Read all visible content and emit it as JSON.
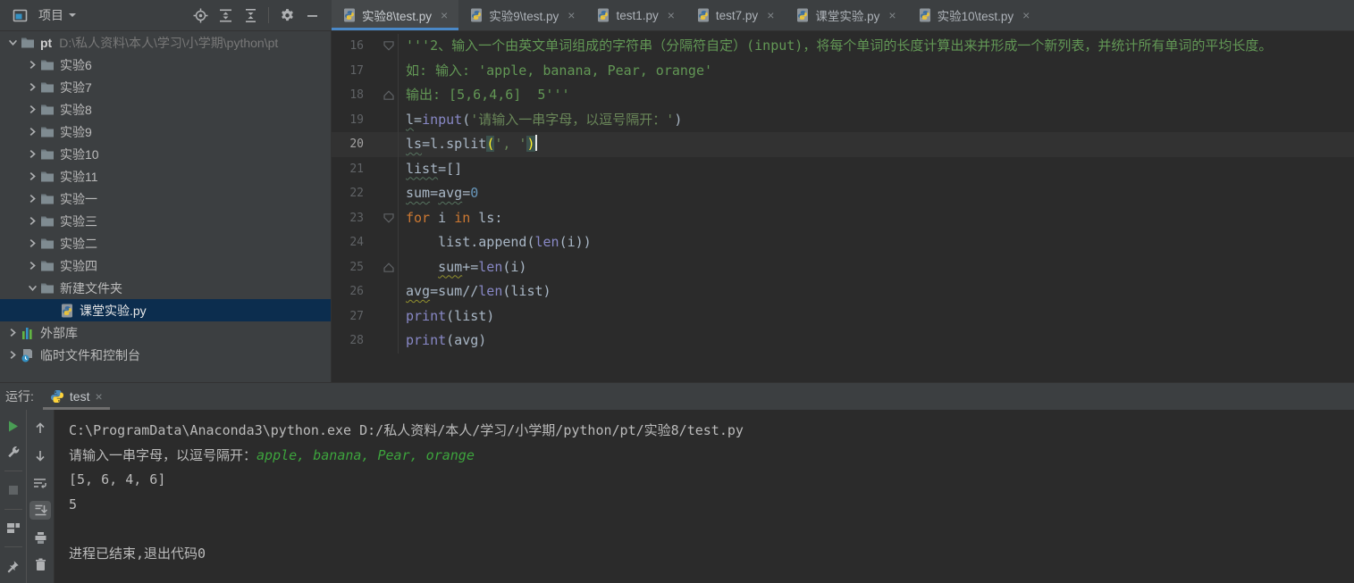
{
  "colors": {
    "accent_blue": "#4A88C7",
    "selection_navy": "#0C2D4E",
    "run_green": "#499C54",
    "console_input_green": "#3DA43D",
    "editor_bg": "#2B2B2B",
    "panel_bg": "#3C3F41"
  },
  "toolbar": {
    "project_label": "项目",
    "icons": [
      "locate",
      "expand-all",
      "collapse-all",
      "settings",
      "hide"
    ]
  },
  "editor_tabs": [
    {
      "label": "实验8\\test.py",
      "active": true
    },
    {
      "label": "实验9\\test.py",
      "active": false
    },
    {
      "label": "test1.py",
      "active": false
    },
    {
      "label": "test7.py",
      "active": false
    },
    {
      "label": "课堂实验.py",
      "active": false
    },
    {
      "label": "实验10\\test.py",
      "active": false
    }
  ],
  "project_tree": {
    "root": {
      "name": "pt",
      "path": "D:\\私人资料\\本人\\学习\\小学期\\python\\pt"
    },
    "items": [
      {
        "label": "实验6",
        "type": "folder",
        "chevron": "collapsed",
        "indent": 1
      },
      {
        "label": "实验7",
        "type": "folder",
        "chevron": "collapsed",
        "indent": 1
      },
      {
        "label": "实验8",
        "type": "folder",
        "chevron": "collapsed",
        "indent": 1
      },
      {
        "label": "实验9",
        "type": "folder",
        "chevron": "collapsed",
        "indent": 1
      },
      {
        "label": "实验10",
        "type": "folder",
        "chevron": "collapsed",
        "indent": 1
      },
      {
        "label": "实验11",
        "type": "folder",
        "chevron": "collapsed",
        "indent": 1
      },
      {
        "label": "实验一",
        "type": "folder",
        "chevron": "collapsed",
        "indent": 1
      },
      {
        "label": "实验三",
        "type": "folder",
        "chevron": "collapsed",
        "indent": 1
      },
      {
        "label": "实验二",
        "type": "folder",
        "chevron": "collapsed",
        "indent": 1
      },
      {
        "label": "实验四",
        "type": "folder",
        "chevron": "collapsed",
        "indent": 1
      },
      {
        "label": "新建文件夹",
        "type": "folder",
        "chevron": "expanded",
        "indent": 1
      },
      {
        "label": "课堂实验.py",
        "type": "pyfile",
        "chevron": "none",
        "indent": 2,
        "selected": true
      },
      {
        "label": "外部库",
        "type": "library",
        "chevron": "collapsed",
        "indent": 0
      },
      {
        "label": "临时文件和控制台",
        "type": "scratch",
        "chevron": "collapsed",
        "indent": 0
      }
    ]
  },
  "editor": {
    "lines": [
      {
        "no": "16",
        "fold": "down",
        "seg": [
          [
            "doc",
            "'''2、输入一个由英文单词组成的字符串（分隔符自定）(input)，将每个单词的长度计算出来并形成一个新列表，并统计所有单词的平均长度。"
          ]
        ]
      },
      {
        "no": "17",
        "fold": "none",
        "seg": [
          [
            "doc",
            "如: 输入: 'apple, banana, Pear, orange'"
          ]
        ]
      },
      {
        "no": "18",
        "fold": "up",
        "seg": [
          [
            "doc",
            "输出: [5,6,4,6]  5'''"
          ]
        ]
      },
      {
        "no": "19",
        "fold": "none",
        "seg": [
          [
            "pl wavy",
            "l"
          ],
          [
            "pl",
            "="
          ],
          [
            "fn",
            "input"
          ],
          [
            "pl",
            "("
          ],
          [
            "str",
            "'请输入一串字母，以逗号隔开：'"
          ],
          [
            "pl",
            ")"
          ]
        ]
      },
      {
        "no": "20",
        "fold": "none",
        "current": true,
        "caret": true,
        "seg": [
          [
            "pl wavy",
            "ls"
          ],
          [
            "pl",
            "="
          ],
          [
            "pl",
            "l.split"
          ],
          [
            "brace",
            "("
          ],
          [
            "str",
            "', '"
          ],
          [
            "brace",
            ")"
          ]
        ]
      },
      {
        "no": "21",
        "fold": "none",
        "seg": [
          [
            "pl wavy",
            "list"
          ],
          [
            "pl",
            "=[]"
          ]
        ]
      },
      {
        "no": "22",
        "fold": "none",
        "seg": [
          [
            "pl wavy",
            "sum"
          ],
          [
            "pl",
            "="
          ],
          [
            "pl wavy",
            "avg"
          ],
          [
            "pl",
            "="
          ],
          [
            "num",
            "0"
          ]
        ]
      },
      {
        "no": "23",
        "fold": "down",
        "seg": [
          [
            "kw",
            "for"
          ],
          [
            "pl",
            " i "
          ],
          [
            "kw",
            "in"
          ],
          [
            "pl",
            " ls:"
          ]
        ]
      },
      {
        "no": "24",
        "fold": "none",
        "seg": [
          [
            "pl",
            "    list.append("
          ],
          [
            "fn",
            "len"
          ],
          [
            "pl",
            "(i))"
          ]
        ]
      },
      {
        "no": "25",
        "fold": "up",
        "seg": [
          [
            "pl",
            "    "
          ],
          [
            "pl wavy2",
            "sum"
          ],
          [
            "pl",
            "+="
          ],
          [
            "fn",
            "len"
          ],
          [
            "pl",
            "(i)"
          ]
        ]
      },
      {
        "no": "26",
        "fold": "none",
        "seg": [
          [
            "pl wavy2",
            "avg"
          ],
          [
            "pl",
            "=sum//"
          ],
          [
            "fn",
            "len"
          ],
          [
            "pl",
            "(list)"
          ]
        ]
      },
      {
        "no": "27",
        "fold": "none",
        "seg": [
          [
            "fn",
            "print"
          ],
          [
            "pl",
            "(list)"
          ]
        ]
      },
      {
        "no": "28",
        "fold": "none",
        "seg": [
          [
            "fn",
            "print"
          ],
          [
            "pl",
            "(avg)"
          ]
        ]
      }
    ]
  },
  "run_panel": {
    "label": "运行:",
    "tab_label": "test",
    "left_toolbar": [
      "rerun",
      "settings-wrench",
      "stop",
      "restore-layout",
      "pin"
    ],
    "right_toolbar": [
      "up",
      "down",
      "soft-wrap",
      "scroll-to-end",
      "print",
      "clear"
    ],
    "scroll_to_end_selected": true,
    "console_lines": [
      [
        [
          "con",
          "C:\\ProgramData\\Anaconda3\\python.exe D:/私人资料/本人/学习/小学期/python/pt/实验8/test.py"
        ]
      ],
      [
        [
          "con",
          "请输入一串字母，以逗号隔开："
        ],
        [
          "usr",
          "apple, banana, Pear, orange"
        ]
      ],
      [
        [
          "con",
          "[5, 6, 4, 6]"
        ]
      ],
      [
        [
          "con",
          "5"
        ]
      ],
      [
        [
          "con",
          ""
        ]
      ],
      [
        [
          "con",
          "进程已结束,退出代码0"
        ]
      ]
    ]
  }
}
